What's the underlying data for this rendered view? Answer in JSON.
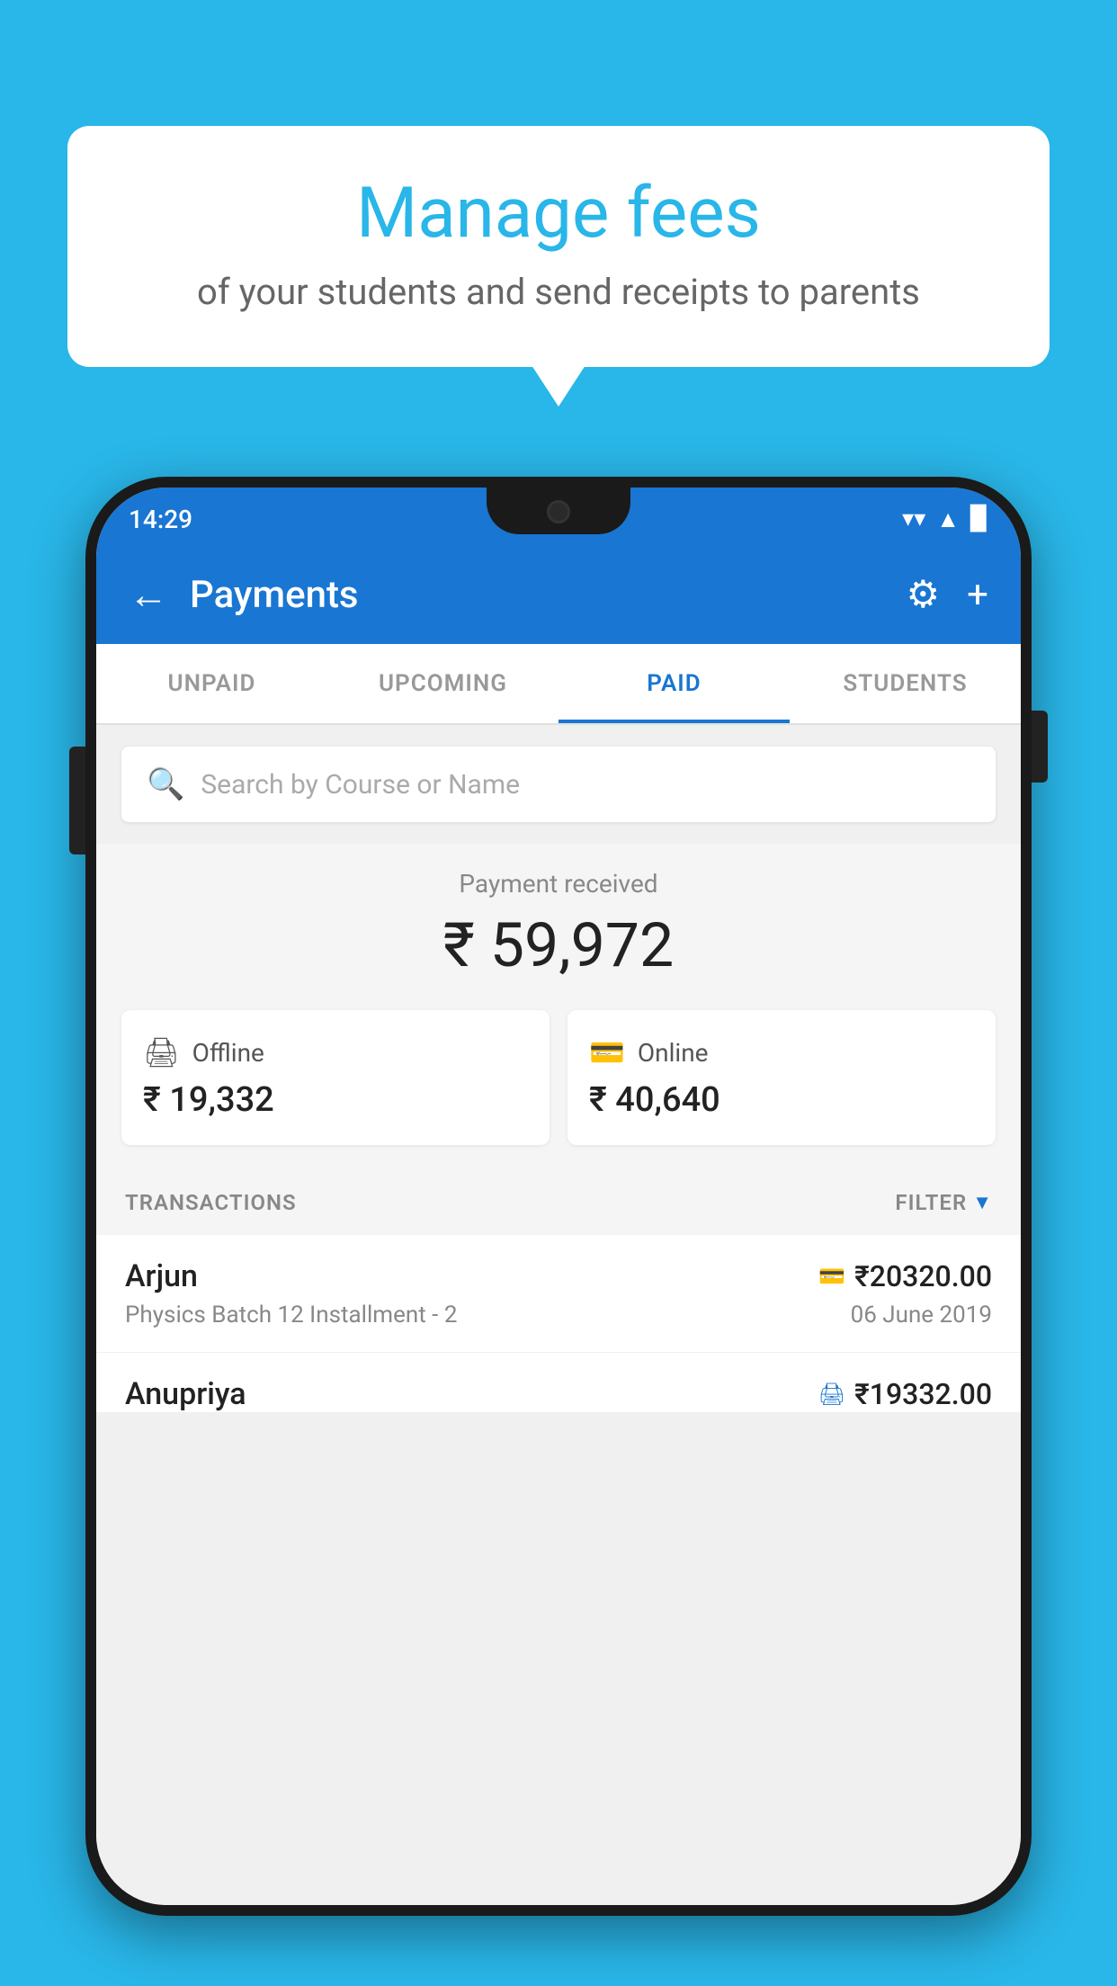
{
  "background_color": "#29b6e8",
  "speech_bubble": {
    "title": "Manage fees",
    "subtitle": "of your students and send receipts to parents"
  },
  "status_bar": {
    "time": "14:29",
    "wifi": "▲",
    "signal": "▲",
    "battery": "▉"
  },
  "app_bar": {
    "title": "Payments",
    "back_label": "←",
    "gear_label": "⚙",
    "plus_label": "+"
  },
  "tabs": [
    {
      "label": "UNPAID",
      "active": false
    },
    {
      "label": "UPCOMING",
      "active": false
    },
    {
      "label": "PAID",
      "active": true
    },
    {
      "label": "STUDENTS",
      "active": false
    }
  ],
  "search": {
    "placeholder": "Search by Course or Name"
  },
  "payment_section": {
    "label": "Payment received",
    "total": "₹ 59,972",
    "offline_label": "Offline",
    "offline_amount": "₹ 19,332",
    "online_label": "Online",
    "online_amount": "₹ 40,640"
  },
  "transactions_header": {
    "label": "TRANSACTIONS",
    "filter": "FILTER"
  },
  "transactions": [
    {
      "name": "Arjun",
      "course": "Physics Batch 12 Installment - 2",
      "amount": "₹20320.00",
      "date": "06 June 2019",
      "payment_type": "online"
    },
    {
      "name": "Anupriya",
      "course": "",
      "amount": "₹19332.00",
      "date": "",
      "payment_type": "offline"
    }
  ]
}
